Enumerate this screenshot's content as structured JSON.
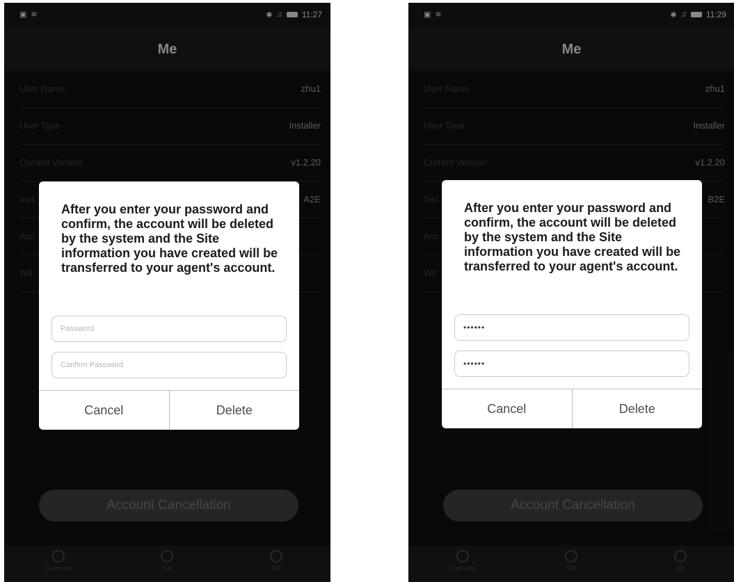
{
  "screens": [
    {
      "status": {
        "time": "11:27"
      },
      "header_title": "Me",
      "rows": [
        {
          "label": "User Name",
          "value": "zhu1"
        },
        {
          "label": "User Type",
          "value": "Installer"
        },
        {
          "label": "Current Version",
          "value": "v1.2.20"
        },
        {
          "label": "Inst",
          "value": "A2E"
        },
        {
          "label": "Acc",
          "value": ""
        },
        {
          "label": "Wit",
          "value": ""
        }
      ],
      "dialog": {
        "message": "After you enter your password and confirm, the account will be deleted by the system and the Site information you have created will be transferred to your agent's account.",
        "password_placeholder": "Password",
        "password_value": "",
        "confirm_placeholder": "Confirm Password",
        "confirm_value": "",
        "cancel_label": "Cancel",
        "delete_label": "Delete"
      },
      "account_cancellation_label": "Account Cancellation",
      "tabs": [
        {
          "label": "Overview",
          "icon": "overview-icon"
        },
        {
          "label": "Site",
          "icon": "site-icon"
        },
        {
          "label": "Me",
          "icon": "me-icon"
        }
      ]
    },
    {
      "status": {
        "time": "11:29"
      },
      "header_title": "Me",
      "rows": [
        {
          "label": "User Name",
          "value": "zhu1"
        },
        {
          "label": "User Type",
          "value": "Installer"
        },
        {
          "label": "Current Version",
          "value": "v1.2.20"
        },
        {
          "label": "Inst",
          "value": "B2E"
        },
        {
          "label": "Acc",
          "value": ""
        },
        {
          "label": "Wit",
          "value": ""
        }
      ],
      "dialog": {
        "message": "After you enter your password and confirm, the account will be deleted by the system and the Site information you have created will be transferred to your agent's account.",
        "password_placeholder": "",
        "password_value": "••••••",
        "confirm_placeholder": "",
        "confirm_value": "••••••",
        "cancel_label": "Cancel",
        "delete_label": "Delete"
      },
      "account_cancellation_label": "Account Cancellation",
      "tabs": [
        {
          "label": "Overview",
          "icon": "overview-icon"
        },
        {
          "label": "Site",
          "icon": "site-icon"
        },
        {
          "label": "Me",
          "icon": "me-icon"
        }
      ]
    }
  ]
}
